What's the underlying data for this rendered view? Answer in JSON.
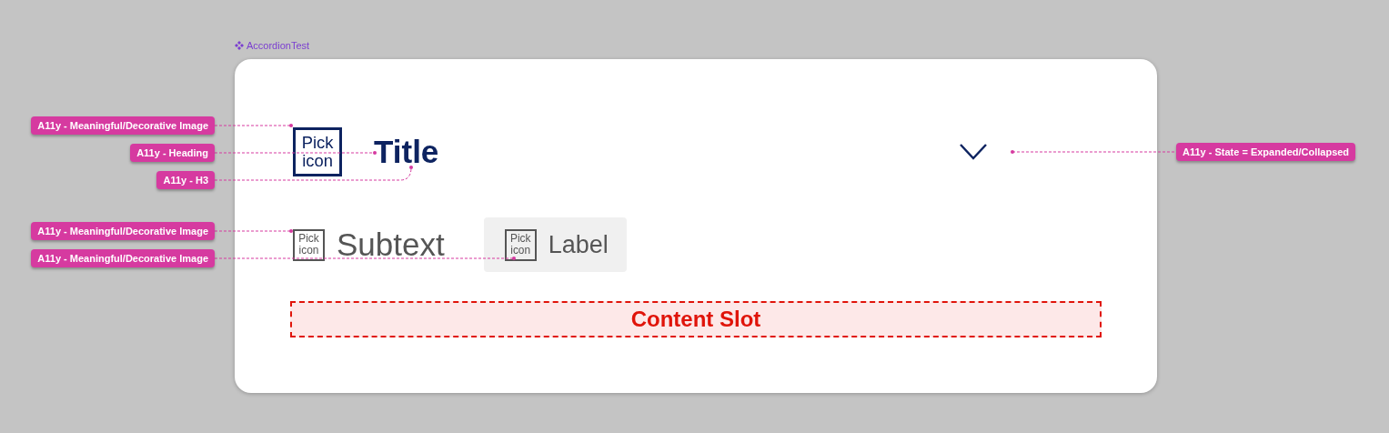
{
  "frame": {
    "name": "AccordionTest"
  },
  "accordion": {
    "expanded": false,
    "header": {
      "icon": [
        "Pick",
        "icon"
      ],
      "title": "Title"
    },
    "subtext": {
      "icon": [
        "Pick",
        "icon"
      ],
      "text": "Subtext"
    },
    "label_chip": {
      "icon": [
        "Pick",
        "icon"
      ],
      "text": "Label"
    },
    "content_slot": "Content Slot"
  },
  "annotations": [
    {
      "text": "A11y - Meaningful/Decorative Image",
      "kind": "left"
    },
    {
      "text": "A11y - Heading",
      "kind": "left"
    },
    {
      "text": "A11y - H3",
      "kind": "left"
    },
    {
      "text": "A11y - Meaningful/Decorative Image",
      "kind": "left"
    },
    {
      "text": "A11y - Meaningful/Decorative Image",
      "kind": "left"
    },
    {
      "text": "A11y - State = Expanded/Collapsed",
      "kind": "right"
    }
  ]
}
